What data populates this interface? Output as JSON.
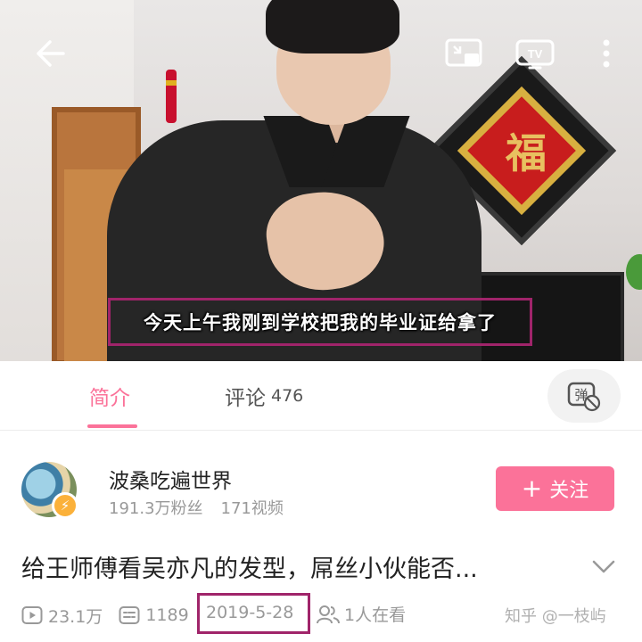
{
  "player": {
    "subtitle": "今天上午我刚到学校把我的毕业证给拿了",
    "wall_decoration_char": "福",
    "watermark": "知乎 @一枝屿",
    "controls": {
      "back": "back-arrow-icon",
      "pip": "picture-in-picture-icon",
      "cast": "tv-cast-icon",
      "more": "more-vertical-icon"
    }
  },
  "tabs": [
    {
      "label": "简介",
      "active": true
    },
    {
      "label": "评论",
      "count": "476",
      "active": false
    }
  ],
  "danmaku_toggle": {
    "label": "弹",
    "state": "off"
  },
  "uploader": {
    "name": "波桑吃遍世界",
    "followers": "191.3万粉丝",
    "videos": "171视频",
    "follow_label": "关注",
    "verified": true
  },
  "video": {
    "title": "给王师傅看吴亦凡的发型，屌丝小伙能否...",
    "views": "23.1万",
    "danmaku_count": "1189",
    "date": "2019-5-28",
    "watching": "1人在看"
  },
  "watermark": "知乎 @一枝屿",
  "colors": {
    "accent": "#fb7299",
    "highlight_box": "#a0246a",
    "secondary_text": "#999999"
  }
}
